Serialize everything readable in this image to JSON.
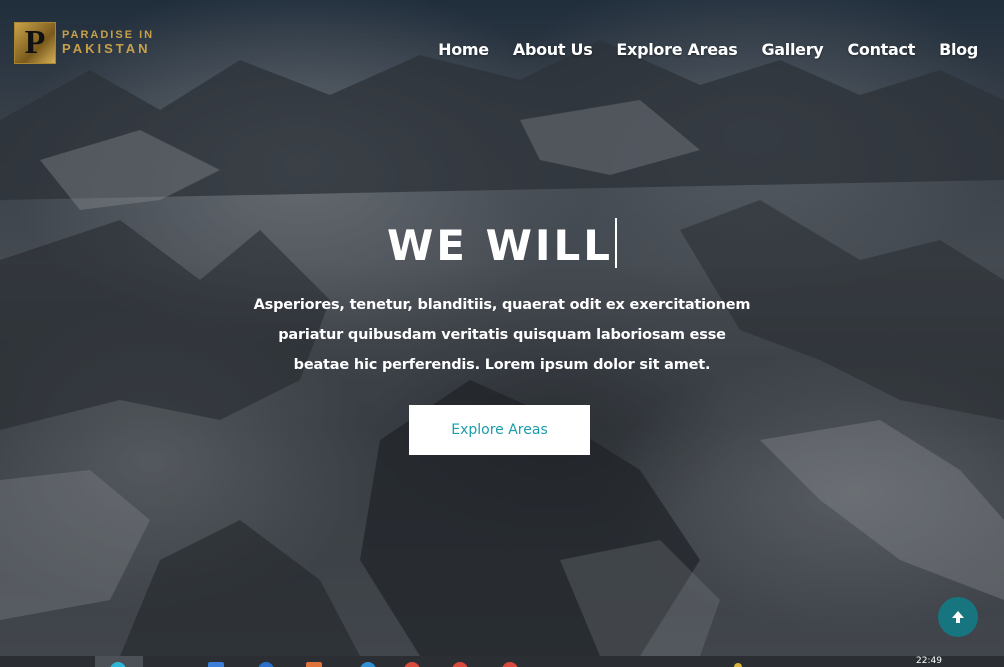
{
  "brand": {
    "initial": "P",
    "line1": "PARADISE IN",
    "line2": "PAKISTAN"
  },
  "nav": {
    "items": [
      {
        "label": "Home"
      },
      {
        "label": "About Us"
      },
      {
        "label": "Explore Areas"
      },
      {
        "label": "Gallery"
      },
      {
        "label": "Contact"
      },
      {
        "label": "Blog"
      }
    ]
  },
  "hero": {
    "headline": "WE WILL",
    "paragraph": "Asperiores, tenetur, blanditiis, quaerat odit ex exercitationem pariatur quibusdam veritatis quisquam laboriosam esse beatae hic perferendis. Lorem ipsum dolor sit amet.",
    "cta_label": "Explore Areas"
  },
  "scroll_top": {
    "icon": "arrow-up-icon"
  },
  "taskbar": {
    "clock": "22:49"
  },
  "colors": {
    "accent": "#1a9cab",
    "scroll_button": "#17757f",
    "brand_gold": "#c8a04a"
  }
}
